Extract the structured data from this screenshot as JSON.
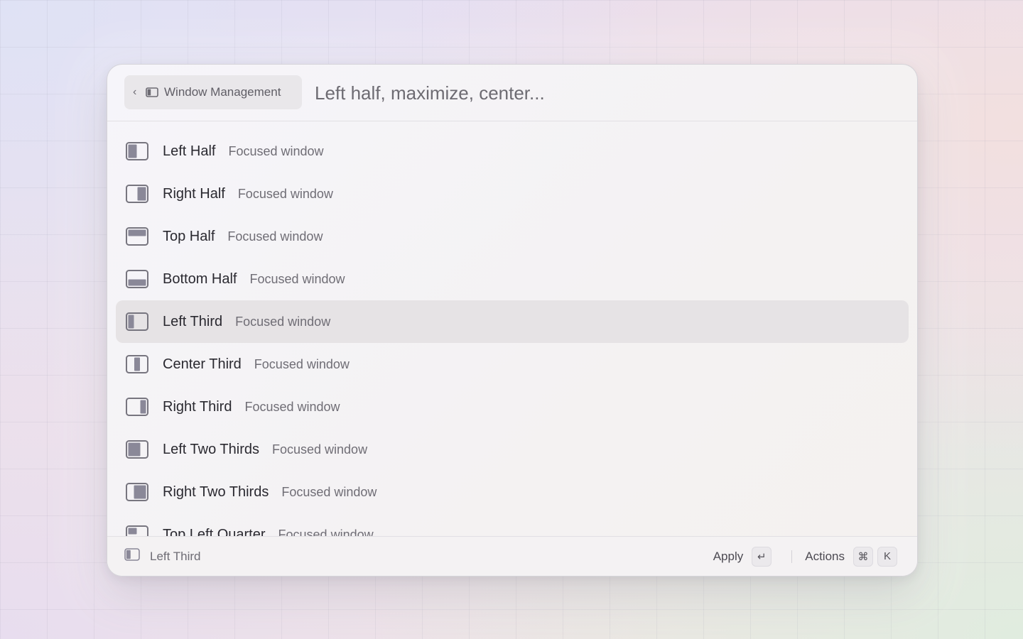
{
  "header": {
    "breadcrumb_label": "Window Management",
    "search_placeholder": "Left half, maximize, center..."
  },
  "items": [
    {
      "title": "Left Half",
      "subtitle": "Focused window",
      "icon": "left-half-icon"
    },
    {
      "title": "Right Half",
      "subtitle": "Focused window",
      "icon": "right-half-icon"
    },
    {
      "title": "Top Half",
      "subtitle": "Focused window",
      "icon": "top-half-icon"
    },
    {
      "title": "Bottom Half",
      "subtitle": "Focused window",
      "icon": "bottom-half-icon"
    },
    {
      "title": "Left Third",
      "subtitle": "Focused window",
      "icon": "left-third-icon",
      "selected": true
    },
    {
      "title": "Center Third",
      "subtitle": "Focused window",
      "icon": "center-third-icon"
    },
    {
      "title": "Right Third",
      "subtitle": "Focused window",
      "icon": "right-third-icon"
    },
    {
      "title": "Left Two Thirds",
      "subtitle": "Focused window",
      "icon": "left-two-thirds-icon"
    },
    {
      "title": "Right Two Thirds",
      "subtitle": "Focused window",
      "icon": "right-two-thirds-icon"
    },
    {
      "title": "Top Left Quarter",
      "subtitle": "Focused window",
      "icon": "top-left-quarter-icon"
    }
  ],
  "footer": {
    "current_label": "Left Third",
    "apply_label": "Apply",
    "apply_key": "↵",
    "actions_label": "Actions",
    "actions_keys": [
      "⌘",
      "K"
    ]
  },
  "colors": {
    "icon_fill": "#8a8898",
    "icon_stroke": "#77757f",
    "selected_row": "#e6e3e5"
  }
}
